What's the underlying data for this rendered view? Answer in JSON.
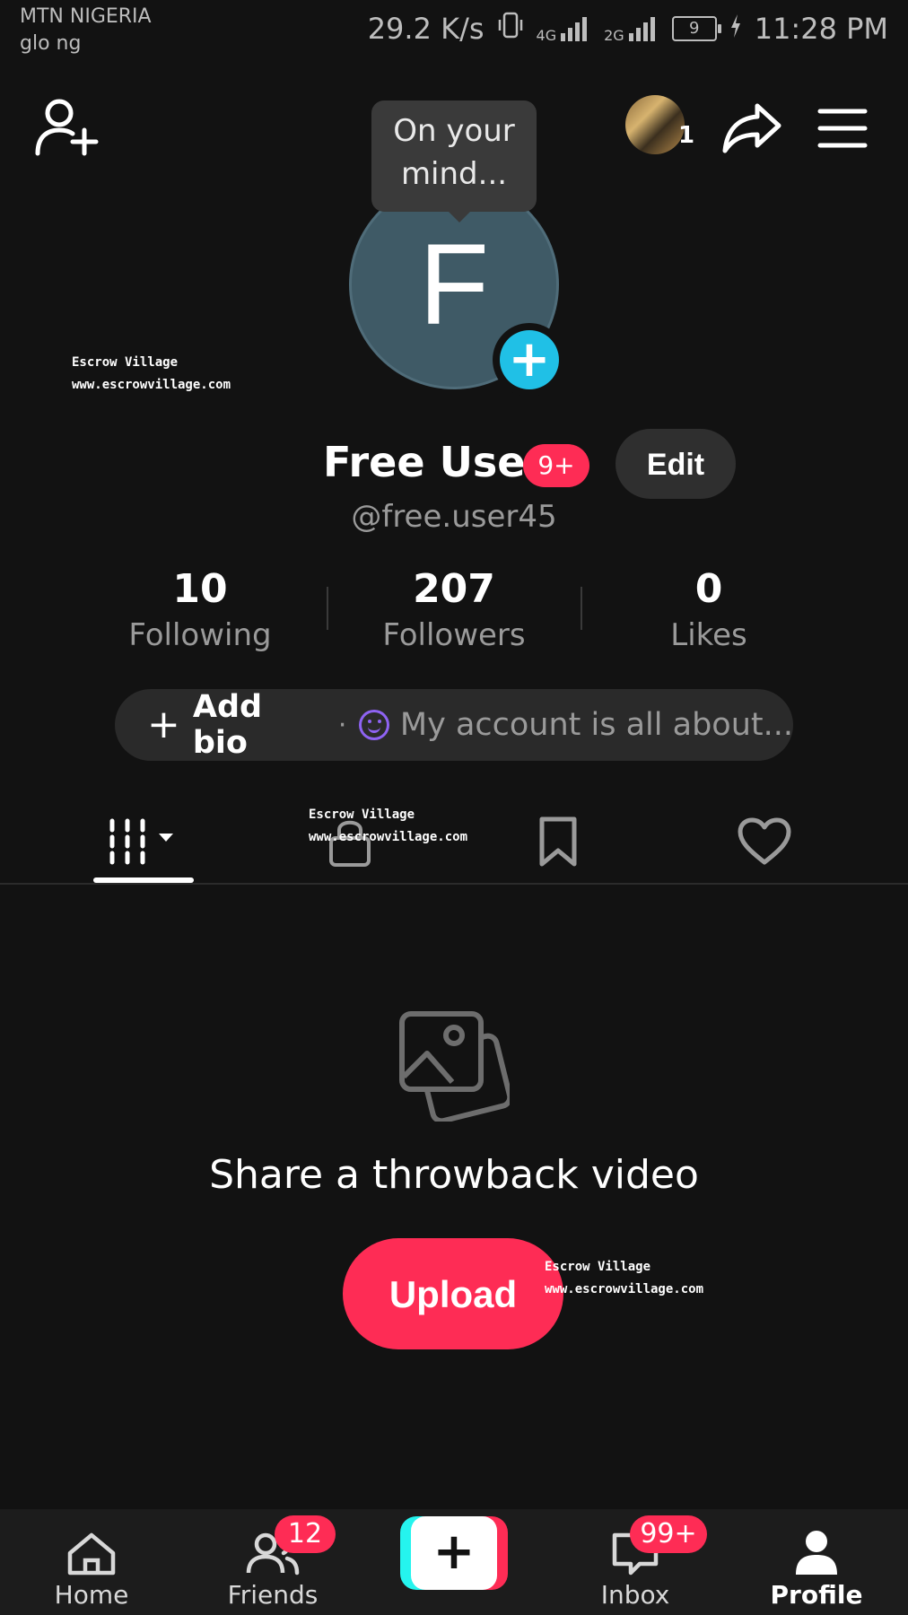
{
  "status_bar": {
    "carrier_primary": "MTN NIGERIA",
    "carrier_secondary": "glo ng",
    "speed": "29.2 K/s",
    "net1": "4G",
    "net2": "2G",
    "battery": "9",
    "time": "11:28 PM"
  },
  "header": {
    "add_friend_icon": "person-plus-icon",
    "story_count": "1",
    "share_icon": "share-arrow-icon",
    "menu_icon": "hamburger-menu-icon"
  },
  "tooltip": {
    "line1": "On your",
    "line2": "mind..."
  },
  "profile": {
    "avatar_letter": "F",
    "avatar_color": "#3f5a66",
    "name": "Free User",
    "name_badge": "9+",
    "edit_label": "Edit",
    "handle": "@free.user45"
  },
  "stats": [
    {
      "value": "10",
      "label": "Following"
    },
    {
      "value": "207",
      "label": "Followers"
    },
    {
      "value": "0",
      "label": "Likes"
    }
  ],
  "bio": {
    "add_label": "Add bio",
    "separator": "·",
    "placeholder": "My account is all about..."
  },
  "tabs": [
    {
      "icon": "videos-grid-icon",
      "active": true
    },
    {
      "icon": "lock-icon",
      "active": false
    },
    {
      "icon": "bookmark-icon",
      "active": false
    },
    {
      "icon": "heart-icon",
      "active": false
    }
  ],
  "empty_state": {
    "icon": "photos-icon",
    "title": "Share a throwback video",
    "button": "Upload"
  },
  "watermark": {
    "line1": "Escrow Village",
    "line2": "www.escrowvillage.com"
  },
  "bottom_nav": {
    "home": "Home",
    "friends": "Friends",
    "friends_badge": "12",
    "inbox": "Inbox",
    "inbox_badge": "99+",
    "profile": "Profile",
    "create_icon": "plus-icon"
  },
  "colors": {
    "accent": "#fe2c55",
    "cyan": "#25f4ee",
    "add_avatar": "#20c0e6",
    "emoji": "#8e63f2"
  }
}
